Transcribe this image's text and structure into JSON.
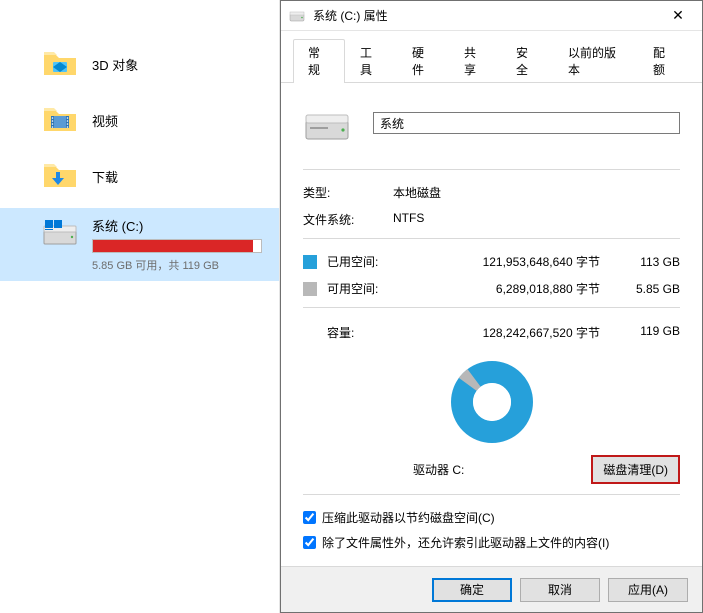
{
  "explorer": {
    "items": [
      {
        "label": "3D 对象",
        "icon": "3d-objects"
      },
      {
        "label": "视频",
        "icon": "videos"
      },
      {
        "label": "下载",
        "icon": "downloads"
      }
    ],
    "drive": {
      "name": "系统 (C:)",
      "subtext": "5.85 GB 可用，共 119 GB",
      "fill_percent": 95
    }
  },
  "dialog": {
    "title": "系统 (C:) 属性",
    "tabs": [
      "常规",
      "工具",
      "硬件",
      "共享",
      "安全",
      "以前的版本",
      "配额"
    ],
    "active_tab": 0,
    "name_value": "系统",
    "type_label": "类型:",
    "type_value": "本地磁盘",
    "fs_label": "文件系统:",
    "fs_value": "NTFS",
    "used": {
      "label": "已用空间:",
      "bytes": "121,953,648,640 字节",
      "human": "113 GB"
    },
    "free": {
      "label": "可用空间:",
      "bytes": "6,289,018,880 字节",
      "human": "5.85 GB"
    },
    "capacity": {
      "label": "容量:",
      "bytes": "128,242,667,520 字节",
      "human": "119 GB"
    },
    "drive_letter": "驱动器 C:",
    "cleanup_btn": "磁盘清理(D)",
    "check1": "压缩此驱动器以节约磁盘空间(C)",
    "check2": "除了文件属性外，还允许索引此驱动器上文件的内容(I)",
    "buttons": {
      "ok": "确定",
      "cancel": "取消",
      "apply": "应用(A)"
    }
  },
  "chart_data": {
    "type": "pie",
    "title": "",
    "series": [
      {
        "name": "已用空间",
        "value": 121953648640,
        "color": "#26a0da"
      },
      {
        "name": "可用空间",
        "value": 6289018880,
        "color": "#b8b8b8"
      }
    ]
  }
}
